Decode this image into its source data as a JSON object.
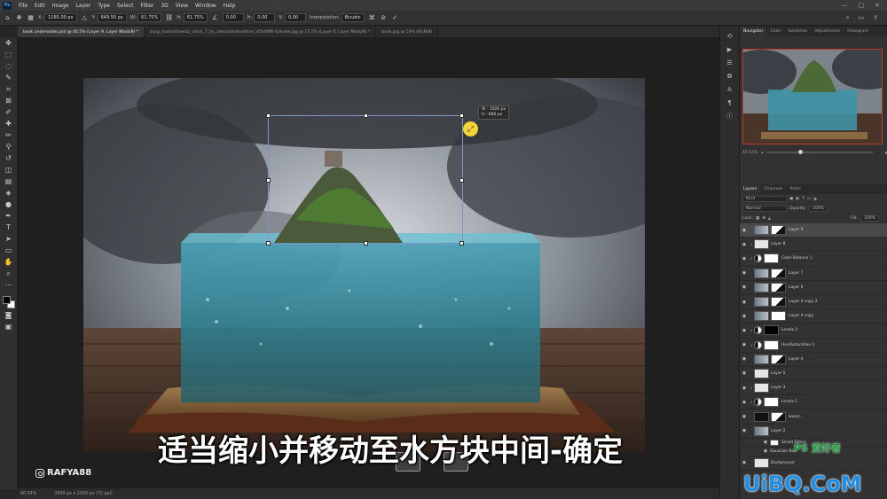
{
  "menu": {
    "logo": "Ps",
    "items": [
      "File",
      "Edit",
      "Image",
      "Layer",
      "Type",
      "Select",
      "Filter",
      "3D",
      "View",
      "Window",
      "Help"
    ],
    "window_controls": [
      "—",
      "□",
      "✕"
    ]
  },
  "options": {
    "x_label": "X:",
    "x_value": "1165.00 px",
    "y_label": "Y:",
    "y_value": "649.50 px",
    "w_label": "W:",
    "w_value": "61.75%",
    "h_label": "H:",
    "h_value": "61.75%",
    "angle_value": "0.00",
    "h_skew_label": "H:",
    "h_skew_value": "0.00",
    "v_skew_label": "V:",
    "v_skew_value": "0.00",
    "interp_label": "Interpolation:",
    "interp_value": "Bicubic"
  },
  "tabs": [
    "book underwater.psd @ 40.5% (Layer 9, Layer Mask/8) *",
    "burg_hochosterwitz_stock_7_by_alexandrahuettner_d5b08f6-fullview.jpg @ 73.1% (Layer 0, Layer Mask/8) *",
    "book.jpg @ 14% (RGB/8)"
  ],
  "status": {
    "zoom": "40.54%",
    "doc": "3000 px x 2000 px (72 ppi)"
  },
  "navigator": {
    "tabs": [
      "Navigator",
      "Color",
      "Swatches",
      "Adjustments",
      "Histogram"
    ],
    "zoom": "40.54%"
  },
  "layers": {
    "tabs": [
      "Layers",
      "Channels",
      "Paths"
    ],
    "kind": "Kind",
    "blend": "Normal",
    "opacity_label": "Opacity:",
    "opacity_value": "100%",
    "lock_label": "Lock:",
    "fill_label": "Fill:",
    "fill_value": "100%",
    "items": [
      "Layer 9",
      "Layer 8",
      "Color Balance 1",
      "Layer 7",
      "Layer 6",
      "Layer 4 copy 2",
      "Layer 4 copy",
      "Levels 2",
      "Hue/Saturation 1",
      "Layer 4",
      "Layer 5",
      "Layer 3",
      "Levels 1",
      "wood...",
      "Layer 2",
      "Smart Filters",
      "Gaussian Blur",
      "Background"
    ]
  },
  "transform_tip": {
    "w": "W : 1020 px",
    "h": "H : 680 px"
  },
  "overlay": {
    "subtitle": "适当缩小并移动至水方块中间-确定",
    "handle": "RAFYA88",
    "watermark": "UiBQ.CoM",
    "ps_mark": "PS 爱好者"
  }
}
